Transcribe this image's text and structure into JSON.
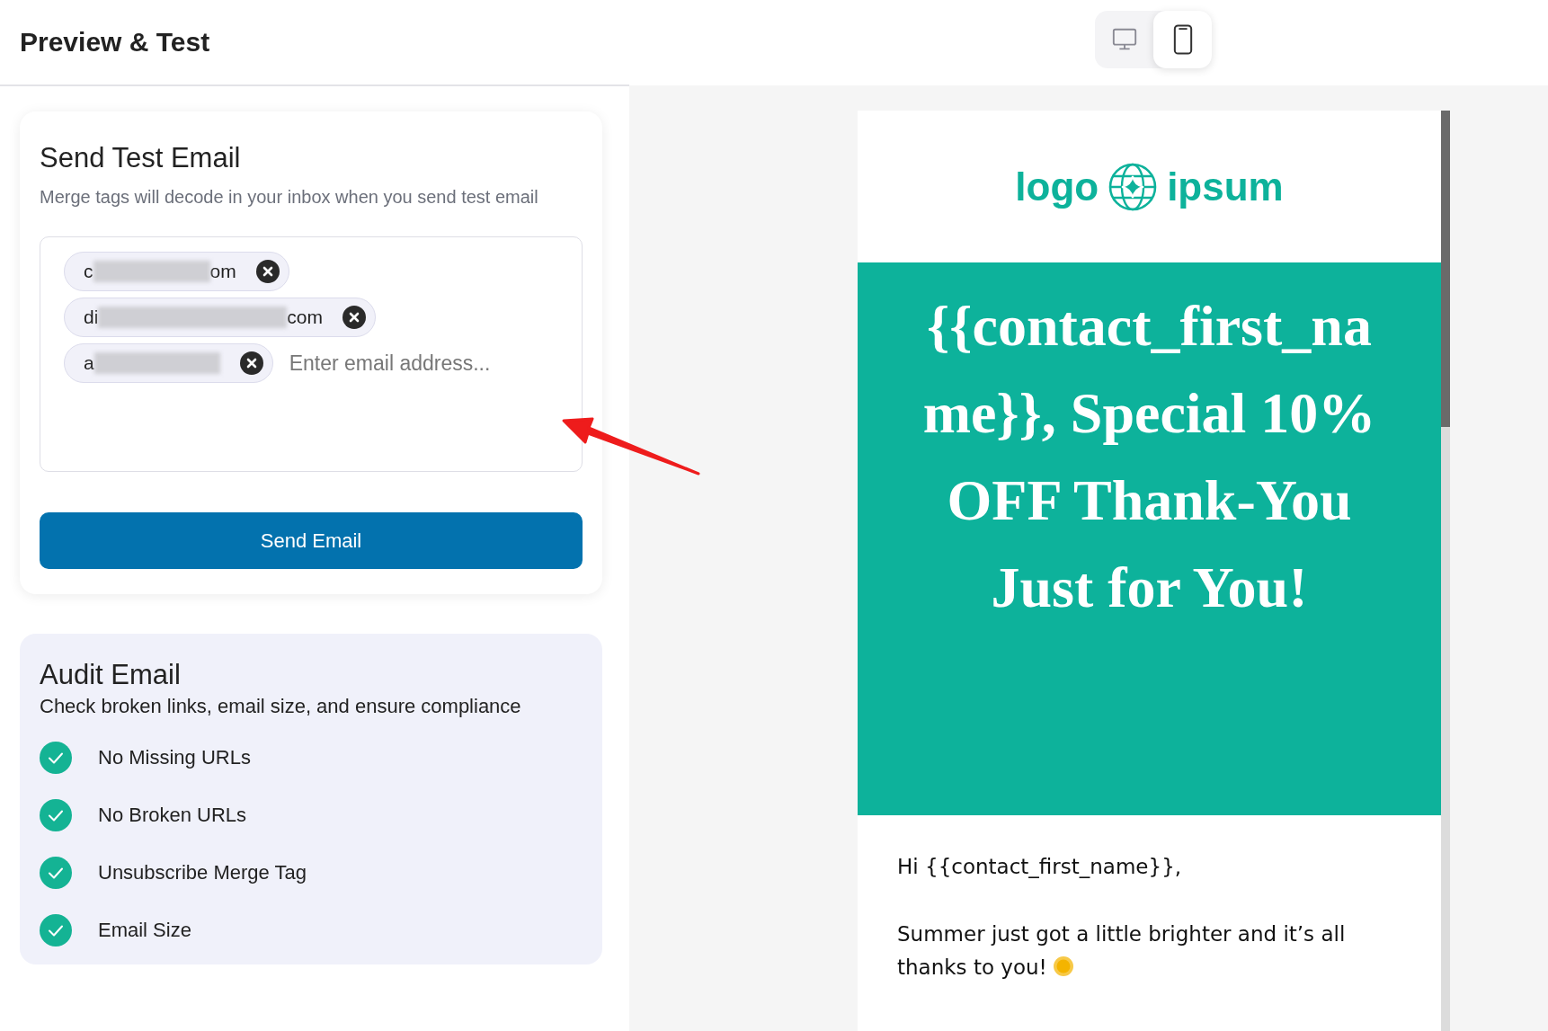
{
  "header": {
    "title": "Preview & Test"
  },
  "device_toggle": [
    {
      "kind": "desktop",
      "selected": false
    },
    {
      "kind": "mobile",
      "selected": true
    }
  ],
  "send_test": {
    "title": "Send Test Email",
    "subtitle": "Merge tags will decode in your inbox when you send test email",
    "recipients": [
      {
        "start": "c",
        "end": "om"
      },
      {
        "start": "di",
        "end": "com"
      },
      {
        "start": "a"
      }
    ],
    "placeholder": "Enter email address...",
    "button": "Send Email"
  },
  "audit": {
    "title": "Audit Email",
    "subtitle": "Check broken links, email size, and ensure compliance",
    "items": [
      {
        "label": "No Missing URLs",
        "passed": true
      },
      {
        "label": "No Broken URLs",
        "passed": true
      },
      {
        "label": "Unsubscribe Merge Tag",
        "passed": true
      },
      {
        "label": "Email Size",
        "passed": true
      }
    ]
  },
  "email_preview": {
    "logo_left": "logo",
    "logo_right": "ipsum",
    "heading": "{{contact_first_name}}, Special 10% OFF Thank-You Just for You!",
    "greeting": "Hi {{contact_first_name}},",
    "paragraph": "Summer just got a little brighter and it’s all thanks to you!"
  }
}
